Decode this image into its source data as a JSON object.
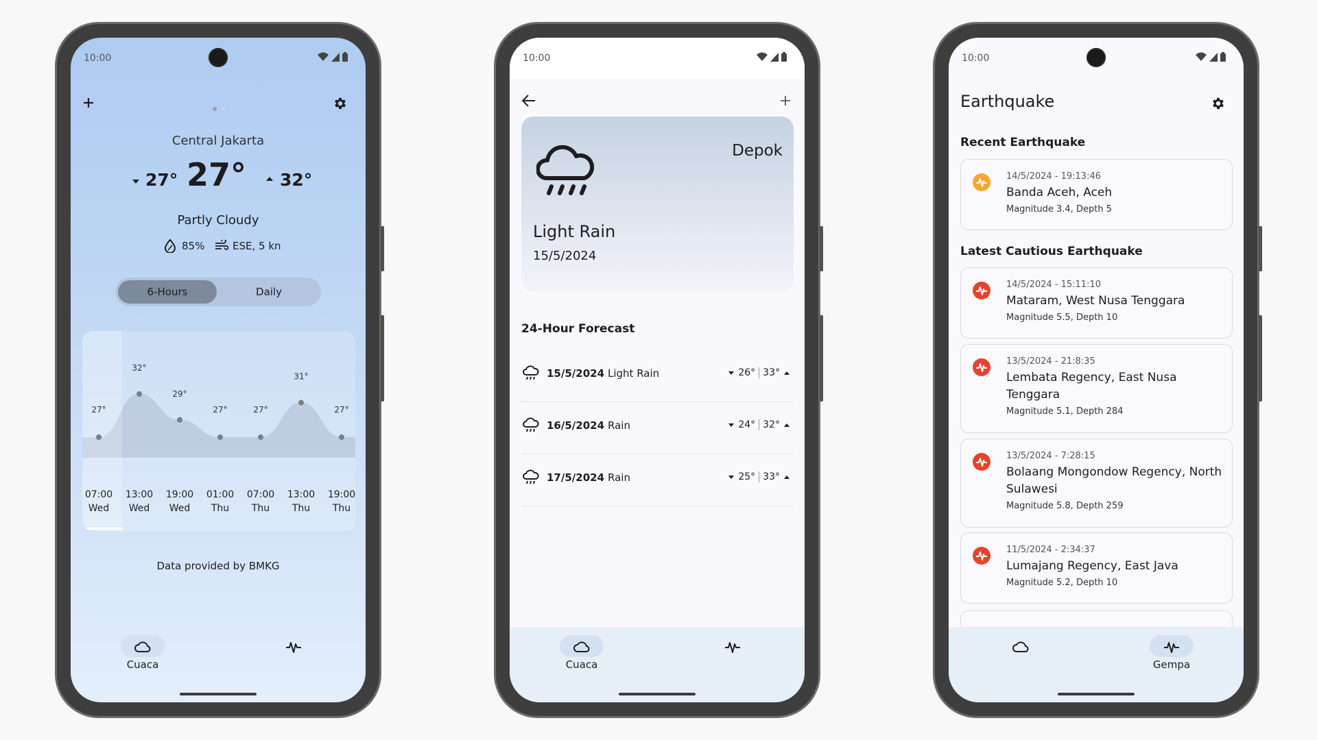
{
  "status_time": "10:00",
  "screen1": {
    "location": "Central Jakarta",
    "temp_min": "27°",
    "temp_now": "27°",
    "temp_max": "32°",
    "condition": "Partly Cloudy",
    "humidity": "85%",
    "wind": "ESE, 5 kn",
    "tabs": [
      "6-Hours",
      "Daily"
    ],
    "selected_tab": "6-Hours",
    "footer": "Data provided by BMKG",
    "chart_data": {
      "type": "area",
      "x": [
        "07:00 Wed",
        "13:00 Wed",
        "19:00 Wed",
        "01:00 Thu",
        "07:00 Thu",
        "13:00 Thu",
        "19:00 Thu"
      ],
      "times": [
        "07:00",
        "13:00",
        "19:00",
        "01:00",
        "07:00",
        "13:00",
        "19:00"
      ],
      "days": [
        "Wed",
        "Wed",
        "Wed",
        "Thu",
        "Thu",
        "Thu",
        "Thu"
      ],
      "values": [
        27,
        32,
        29,
        27,
        27,
        31,
        27
      ],
      "labels": [
        "27°",
        "32°",
        "29°",
        "27°",
        "27°",
        "31°",
        "27°"
      ]
    }
  },
  "screen2": {
    "location": "Depok",
    "condition": "Light Rain",
    "date": "15/5/2024",
    "section_title": "24-Hour Forecast",
    "forecast": [
      {
        "date": "15/5/2024",
        "condition": "Light Rain",
        "min": "26°",
        "max": "33°"
      },
      {
        "date": "16/5/2024",
        "condition": "Rain",
        "min": "24°",
        "max": "32°"
      },
      {
        "date": "17/5/2024",
        "condition": "Rain",
        "min": "25°",
        "max": "33°"
      }
    ]
  },
  "screen3": {
    "title": "Earthquake",
    "recent_title": "Recent Earthquake",
    "cautious_title": "Latest Cautious Earthquake",
    "recent": {
      "time": "14/5/2024 - 19:13:46",
      "place": "Banda Aceh, Aceh",
      "detail": "Magnitude 3.4, Depth 5",
      "color": "#f5a733"
    },
    "cautious": [
      {
        "time": "14/5/2024 - 15:11:10",
        "place": "Mataram, West Nusa Tenggara",
        "detail": "Magnitude 5.5, Depth 10"
      },
      {
        "time": "13/5/2024 - 21:8:35",
        "place": "Lembata Regency, East Nusa Tenggara",
        "detail": "Magnitude 5.1, Depth 284"
      },
      {
        "time": "13/5/2024 - 7:28:15",
        "place": "Bolaang Mongondow Regency, North Sulawesi",
        "detail": "Magnitude 5.8, Depth 259"
      },
      {
        "time": "11/5/2024 - 2:34:37",
        "place": "Lumajang Regency, East Java",
        "detail": "Magnitude 5.2, Depth 10"
      }
    ],
    "alert_color": "#e5432f"
  },
  "nav": {
    "weather": "Cuaca",
    "quake": "Gempa"
  },
  "colors": {
    "nav_active": "#d3e1f3",
    "toggle_active": "#7d8a9c",
    "nav_bg": "#e6eef8"
  }
}
